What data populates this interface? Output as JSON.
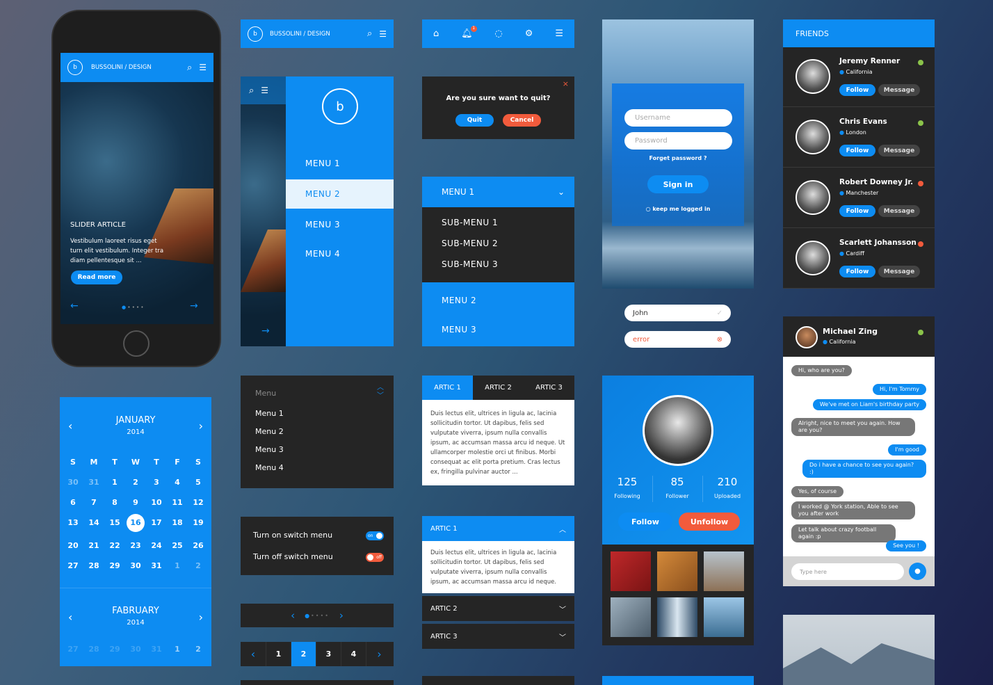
{
  "colors": {
    "accent": "#0d8cf2",
    "danger": "#f25b3c",
    "dark": "#252525",
    "online": "#8bc34a"
  },
  "brand": "BUSSOLINI / DESIGN",
  "phone": {
    "slider_title": "SLIDER ARTICLE",
    "slider_text": "Vestibulum laoreet risus eget turn elit vestibulum. Integer tra diam pellentesque sit ...",
    "read_more": "Read more"
  },
  "sidemenu": {
    "items": [
      "MENU 1",
      "MENU 2",
      "MENU 3",
      "MENU 4"
    ],
    "active": "MENU 2"
  },
  "icons_bar": [
    "home-icon",
    "bell-icon",
    "chat-icon",
    "gear-icon",
    "list-icon"
  ],
  "notification_count": "1",
  "quit_dialog": {
    "question": "Are you sure want to quit?",
    "quit": "Quit",
    "cancel": "Cancel"
  },
  "dropdown": {
    "menu1": "MENU 1",
    "submenus": [
      "SUB-MENU 1",
      "SUB-MENU 2",
      "SUB-MENU 3"
    ],
    "menu2": "MENU 2",
    "menu3": "MENU 3"
  },
  "login": {
    "username_placeholder": "Username",
    "password_placeholder": "Password",
    "forgot": "Forget password ?",
    "sign_in": "Sign in",
    "keep": "keep me logged in"
  },
  "inputs": {
    "valid_value": "John",
    "error_value": "error"
  },
  "friends": {
    "title": "FRIENDS",
    "follow": "Follow",
    "message": "Message",
    "list": [
      {
        "name": "Jeremy Renner",
        "location": "California",
        "status": "online"
      },
      {
        "name": "Chris Evans",
        "location": "London",
        "status": "online"
      },
      {
        "name": "Robert Downey Jr.",
        "location": "Manchester",
        "status": "busy"
      },
      {
        "name": "Scarlett Johansson",
        "location": "Cardiff",
        "status": "busy"
      }
    ]
  },
  "calendar": {
    "month1": "JANUARY",
    "year1": "2014",
    "weekdays": [
      "S",
      "M",
      "T",
      "W",
      "T",
      "F",
      "S"
    ],
    "days": [
      "30",
      "31",
      "1",
      "2",
      "3",
      "4",
      "5",
      "6",
      "7",
      "8",
      "9",
      "10",
      "11",
      "12",
      "13",
      "14",
      "15",
      "16",
      "17",
      "18",
      "19",
      "20",
      "21",
      "22",
      "23",
      "24",
      "25",
      "26",
      "27",
      "28",
      "29",
      "30",
      "31",
      "1",
      "2"
    ],
    "selected": "16",
    "month2": "FABRUARY",
    "year2": "2014",
    "days2": [
      "27",
      "28",
      "29",
      "30",
      "31",
      "1",
      "2"
    ]
  },
  "dark_menu": {
    "title": "Menu",
    "items": [
      "Menu 1",
      "Menu 2",
      "Menu 3",
      "Menu 4"
    ]
  },
  "switches": [
    {
      "label": "Turn on switch menu",
      "state": "on"
    },
    {
      "label": "Turn off switch menu",
      "state": "off"
    }
  ],
  "pager": {
    "dots": 5,
    "active": 1
  },
  "pagination": {
    "pages": [
      "1",
      "2",
      "3",
      "4"
    ],
    "current": "2"
  },
  "tabs": {
    "labels": [
      "ARTIC 1",
      "ARTIC 2",
      "ARTIC 3"
    ],
    "active": 0,
    "content": "Duis lectus elit, ultrices in ligula ac, lacinia sollicitudin tortor. Ut dapibus, felis sed vulputate viverra, ipsum nulla convallis ipsum, ac accumsan massa arcu id neque. Ut ullamcorper molestie orci ut finibus. Morbi consequat ac elit porta pretium. Cras lectus ex, fringilla pulvinar auctor ..."
  },
  "accordion": {
    "items": [
      "ARTIC 1",
      "ARTIC 2",
      "ARTIC 3"
    ],
    "content": "Duis lectus elit, ultrices in ligula ac, lacinia sollicitudin tortor. Ut dapibus, felis sed vulputate viverra, ipsum nulla convallis ipsum, ac accumsan massa arcu id neque."
  },
  "profile": {
    "stats": [
      {
        "value": "125",
        "label": "Following"
      },
      {
        "value": "85",
        "label": "Follower"
      },
      {
        "value": "210",
        "label": "Uploaded"
      }
    ],
    "follow": "Follow",
    "unfollow": "Unfollow"
  },
  "chat": {
    "name": "Michael Zing",
    "location": "California",
    "placeholder": "Type here",
    "messages": [
      {
        "from": "in",
        "text": "Hi, who are you?"
      },
      {
        "from": "out",
        "text": "Hi, I'm Tommy"
      },
      {
        "from": "out",
        "text": "We've met on Liam's birthday party"
      },
      {
        "from": "in",
        "text": "Alright, nice to meet you again. How are you?"
      },
      {
        "from": "out",
        "text": "I'm good"
      },
      {
        "from": "out",
        "text": "Do i have a chance to see you again? :)"
      },
      {
        "from": "in",
        "text": "Yes, of course"
      },
      {
        "from": "in",
        "text": "I worked @ York station, Able to see you after work"
      },
      {
        "from": "in",
        "text": "Let talk about crazy football again :p"
      },
      {
        "from": "out",
        "text": "See you !"
      }
    ]
  }
}
